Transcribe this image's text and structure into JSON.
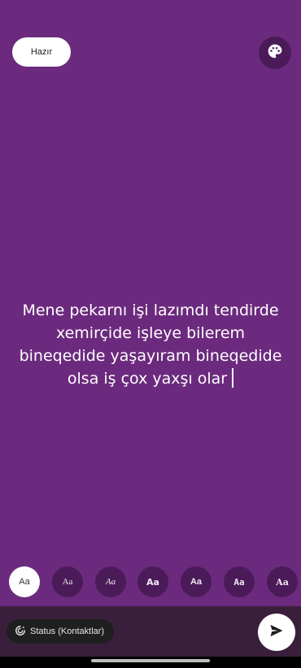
{
  "header": {
    "done_label": "Hazır",
    "palette_icon": "palette-icon"
  },
  "composer": {
    "text": "Mene pekarnı işi lazımdı tendirde xemirçide işleye bilerem bineqedide yaşayıram bineqedide olsa iş çox yaxşı olar",
    "background_color": "#6c2a7e"
  },
  "font_options": [
    {
      "label": "Aa",
      "selected": true
    },
    {
      "label": "Aa",
      "selected": false
    },
    {
      "label": "Aa",
      "selected": false
    },
    {
      "label": "Aa",
      "selected": false
    },
    {
      "label": "Aa",
      "selected": false
    },
    {
      "label": "Aa",
      "selected": false
    },
    {
      "label": "Aa",
      "selected": false
    }
  ],
  "footer": {
    "audience_label": "Status (Kontaktlar)",
    "audience_icon": "status-icon",
    "send_icon": "send-icon"
  }
}
